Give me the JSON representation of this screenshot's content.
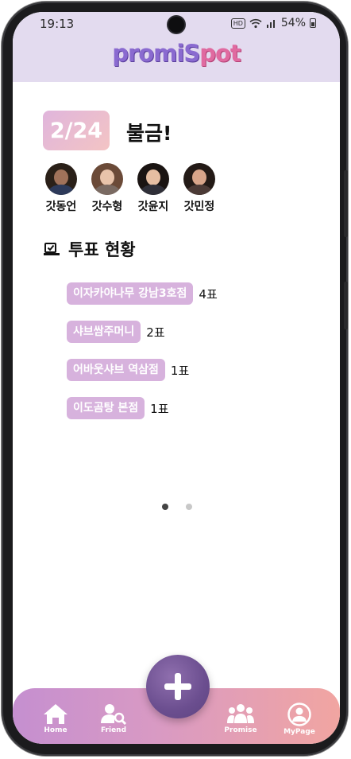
{
  "status_bar": {
    "time": "19:13",
    "hd": "HD",
    "battery": "54%"
  },
  "header": {
    "logo_part1": "promiS",
    "logo_part2": "pot"
  },
  "promise": {
    "date": "2/24",
    "title": "불금!"
  },
  "members": [
    {
      "name": "갓동언",
      "skin": "#a0725a",
      "hair": "#2a2018",
      "shirt": "#2d3a5a"
    },
    {
      "name": "갓수형",
      "skin": "#e8c3aa",
      "hair": "#6b4a38",
      "shirt": "#7a6a62"
    },
    {
      "name": "갓윤지",
      "skin": "#e6bea2",
      "hair": "#1a1412",
      "shirt": "#2f2f38"
    },
    {
      "name": "갓민정",
      "skin": "#d8a58a",
      "hair": "#231a16",
      "shirt": "#4b3a36"
    }
  ],
  "vote": {
    "title": "투표 현황",
    "items": [
      {
        "place": "이자카야나무 강남3호점",
        "count": "4표"
      },
      {
        "place": "샤브쌈주머니",
        "count": "2표"
      },
      {
        "place": "어바웃샤브 역삼점",
        "count": "1표"
      },
      {
        "place": "이도곰탕 본점",
        "count": "1표"
      }
    ]
  },
  "pager": {
    "pages": 2,
    "current": 1
  },
  "nav": {
    "home": "Home",
    "friend": "Friend",
    "promise": "Promise",
    "mypage": "MyPage"
  },
  "colors": {
    "header_bg": "#e3dbef",
    "chip": "#d7b2dd",
    "nav_start": "#c58fd0",
    "nav_end": "#f1a5a1",
    "fab": "#6b4e8f"
  }
}
